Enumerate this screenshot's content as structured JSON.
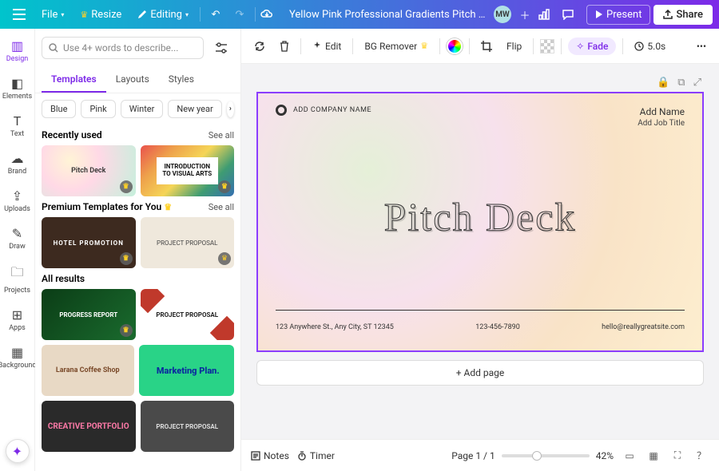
{
  "topbar": {
    "file": "File",
    "resize": "Resize",
    "editing": "Editing",
    "doc_title": "Yellow Pink Professional Gradients Pitch Deck ...",
    "avatar": "MW",
    "present": "Present",
    "share": "Share"
  },
  "rail": {
    "design": "Design",
    "elements": "Elements",
    "text": "Text",
    "brand": "Brand",
    "uploads": "Uploads",
    "draw": "Draw",
    "projects": "Projects",
    "apps": "Apps",
    "background": "Background"
  },
  "panel": {
    "search_ph": "Use 4+ words to describe...",
    "tabs": {
      "templates": "Templates",
      "layouts": "Layouts",
      "styles": "Styles"
    },
    "chips": [
      "Blue",
      "Pink",
      "Winter",
      "New year"
    ],
    "recent_title": "Recently used",
    "premium_title": "Premium Templates for You",
    "all_title": "All results",
    "see_all": "See all",
    "thumbs": {
      "t1": "Pitch Deck",
      "t2": "INTRODUCTION TO VISUAL ARTS",
      "t3": "HOTEL PROMOTION",
      "t4": "PROJECT PROPOSAL",
      "t5": "PROGRESS REPORT",
      "t6": "PROJECT PROPOSAL",
      "t7": "Larana Coffee Shop",
      "t8": "Marketing Plan.",
      "t9": "CREATIVE PORTFOLIO",
      "t10": "PROJECT PROPOSAL"
    }
  },
  "canvas_toolbar": {
    "edit": "Edit",
    "bg_remover": "BG Remover",
    "flip": "Flip",
    "fade": "Fade",
    "duration": "5.0s"
  },
  "slide": {
    "company": "ADD COMPANY NAME",
    "name": "Add Name",
    "job": "Add Job Title",
    "title": "Pitch Deck",
    "address": "123 Anywhere St., Any City, ST 12345",
    "phone": "123-456-7890",
    "email": "hello@reallygreatsite.com"
  },
  "add_page": "+ Add page",
  "bottom": {
    "notes": "Notes",
    "timer": "Timer",
    "page": "Page 1 / 1",
    "zoom": "42%"
  }
}
